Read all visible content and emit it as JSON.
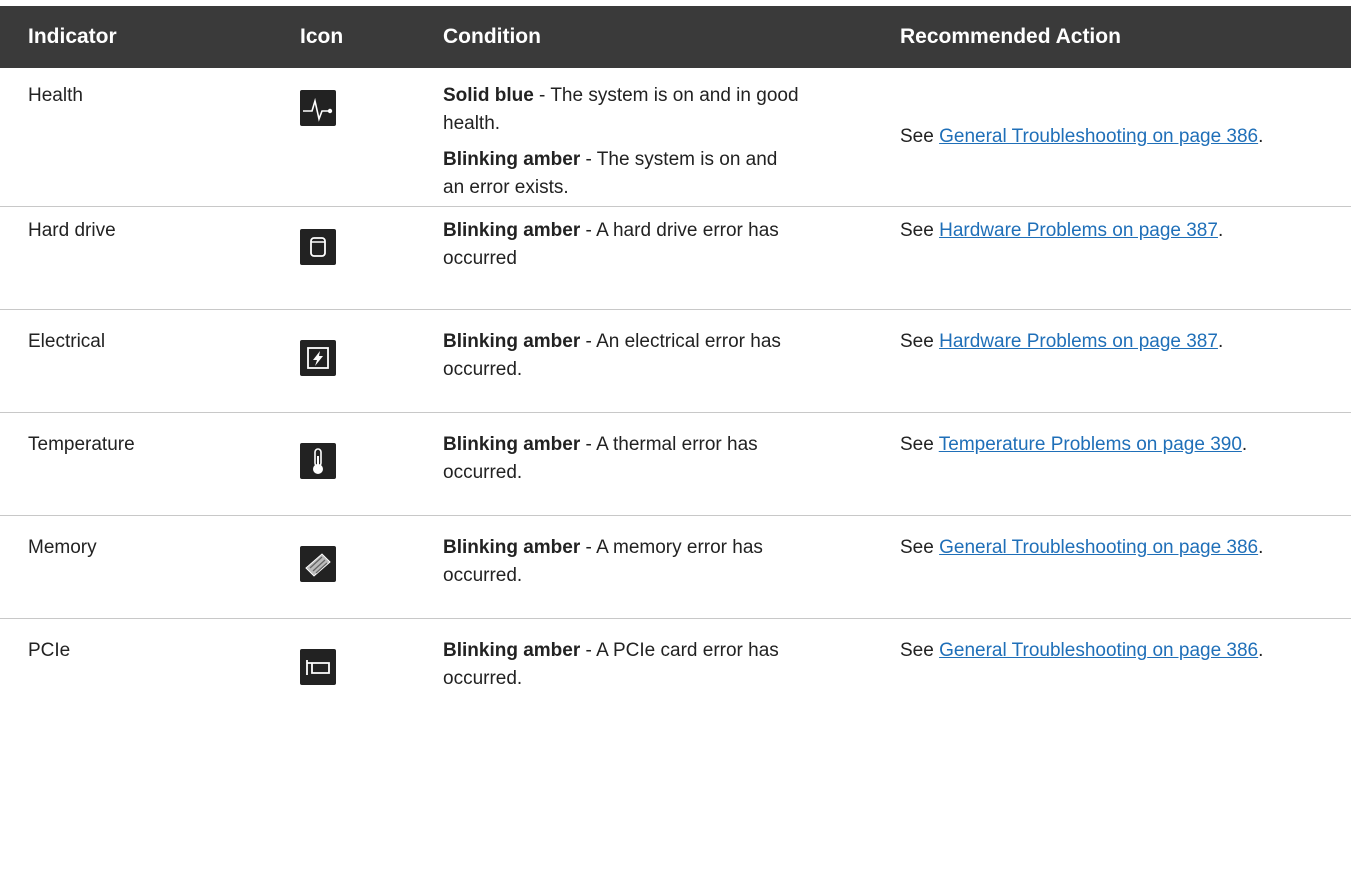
{
  "header": {
    "indicator": "Indicator",
    "icon": "Icon",
    "condition": "Condition",
    "action": "Recommended Action"
  },
  "rows": [
    {
      "indicator": "Health",
      "icon": "health-pulse-icon",
      "conditions": [
        {
          "state": "Solid blue",
          "text": " - The system is on and in good health."
        },
        {
          "state": "Blinking amber",
          "text": " - The system is on and an error exists."
        }
      ],
      "action_prefix": "See ",
      "action_link": "General Troubleshooting",
      "action_on": " on page 386",
      "action_suffix": "."
    },
    {
      "indicator": "Hard drive",
      "icon": "hard-drive-icon",
      "conditions": [
        {
          "state": "Blinking amber",
          "text": " - A hard drive error has occurred"
        }
      ],
      "action_prefix": "See ",
      "action_link": "Hardware Problems",
      "action_on": " on page 387",
      "action_suffix": "."
    },
    {
      "indicator": "Electrical",
      "icon": "electrical-bolt-icon",
      "conditions": [
        {
          "state": "Blinking amber",
          "text": " - An electrical error has occurred."
        }
      ],
      "action_prefix": "See ",
      "action_link": "Hardware Problems",
      "action_on": " on page 387",
      "action_suffix": "."
    },
    {
      "indicator": "Temperature",
      "icon": "thermometer-icon",
      "conditions": [
        {
          "state": "Blinking amber",
          "text": " - A thermal error has occurred."
        }
      ],
      "action_prefix": "See ",
      "action_link": "Temperature Problems",
      "action_on": " on page 390",
      "action_suffix": "."
    },
    {
      "indicator": "Memory",
      "icon": "memory-module-icon",
      "conditions": [
        {
          "state": "Blinking amber",
          "text": " - A memory error has occurred."
        }
      ],
      "action_prefix": "See ",
      "action_link": "General Troubleshooting",
      "action_on": " on page 386",
      "action_suffix": "."
    },
    {
      "indicator": "PCIe",
      "icon": "pcie-card-icon",
      "conditions": [
        {
          "state": "Blinking amber",
          "text": " - A PCIe card error has occurred."
        }
      ],
      "action_prefix": "See ",
      "action_link": "General Troubleshooting",
      "action_on": " on page 386",
      "action_suffix": "."
    }
  ],
  "colors": {
    "header_bg": "#3a3a3a",
    "link": "#1f6fb8",
    "divider": "#c8c8c8"
  }
}
